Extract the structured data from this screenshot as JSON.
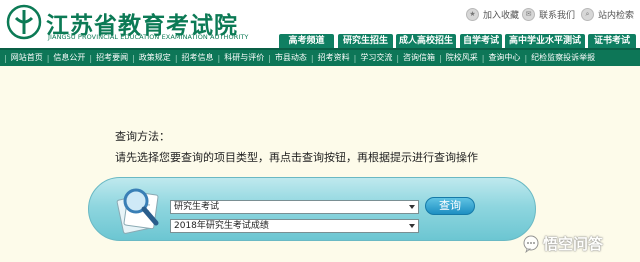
{
  "header": {
    "title_cn": "江苏省教育考试院",
    "title_en": "JIANGSU PROVINCIAL EDUCATION EXAMINATION AUTHORITY",
    "utilities": [
      {
        "label": "加入收藏",
        "icon": "star-icon"
      },
      {
        "label": "联系我们",
        "icon": "contact-icon"
      },
      {
        "label": "站内检索",
        "icon": "search-icon"
      }
    ]
  },
  "category_tabs": [
    {
      "label": "高考频道"
    },
    {
      "label": "研究生招生"
    },
    {
      "label": "成人高校招生"
    },
    {
      "label": "自学考试"
    },
    {
      "label": "高中学业水平测试"
    },
    {
      "label": "证书考试"
    }
  ],
  "nav": [
    "网站首页",
    "信息公开",
    "招考要闻",
    "政策规定",
    "招考信息",
    "科研与评价",
    "市县动态",
    "招考资料",
    "学习交流",
    "咨询信箱",
    "院校风采",
    "查询中心",
    "纪检监察投诉举报"
  ],
  "instructions": {
    "title": "查询方法：",
    "body": "请先选择您要查询的项目类型，再点击查询按钮，再根据提示进行查询操作"
  },
  "query": {
    "select_type": "研究生考试",
    "select_item": "2018年研究生考试成绩",
    "button_label": "查询"
  },
  "watermark": {
    "text": "悟空问答"
  },
  "colors": {
    "brand_green": "#0c7a55",
    "nav_green": "#0d7657",
    "panel_cyan": "#8fd6df",
    "page_bg": "#fdfbea"
  }
}
